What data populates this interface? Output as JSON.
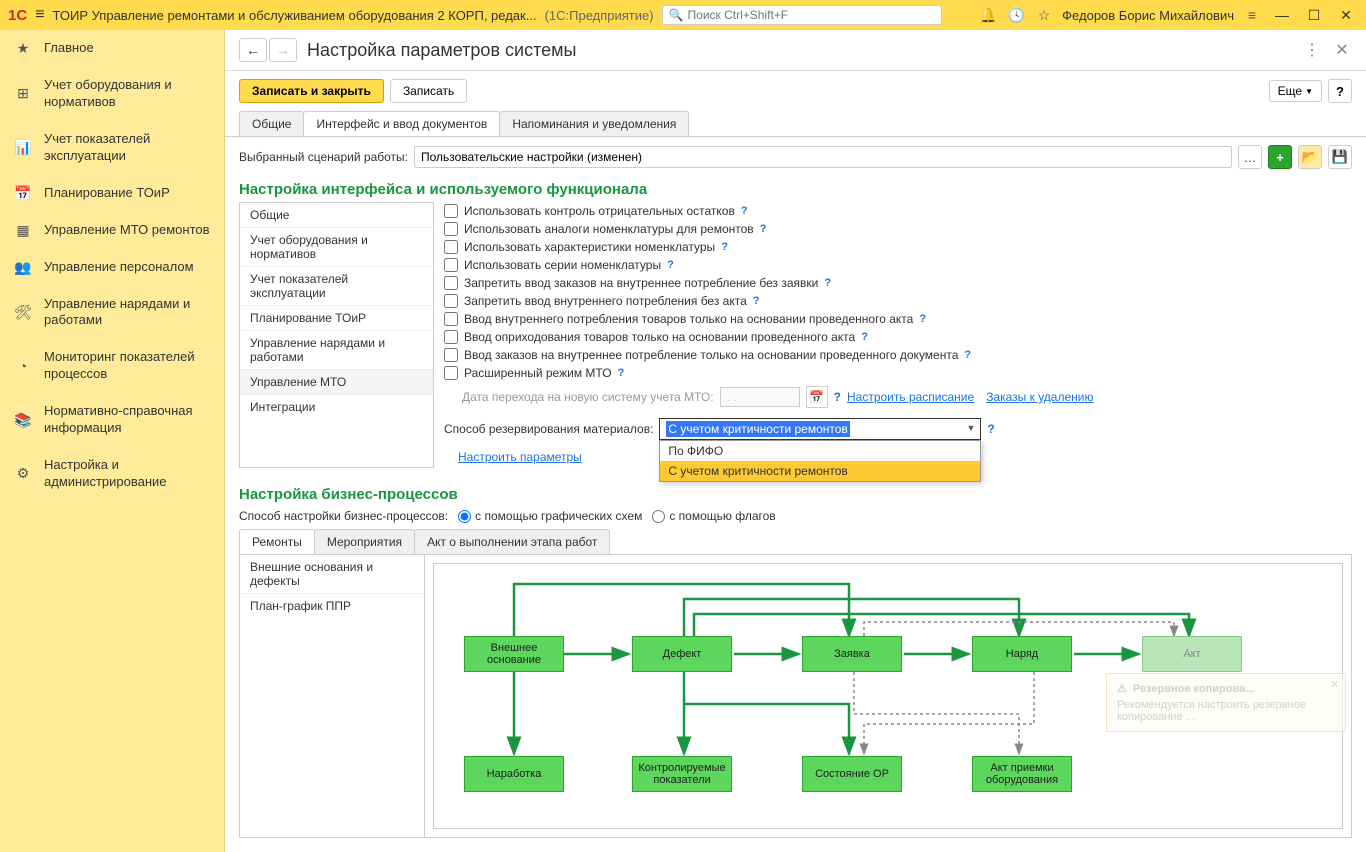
{
  "topbar": {
    "title": "ТОИР Управление ремонтами и обслуживанием оборудования 2 КОРП, редак...",
    "subtitle": "(1С:Предприятие)",
    "search_placeholder": "Поиск Ctrl+Shift+F",
    "username": "Федоров Борис Михайлович"
  },
  "sidebar": [
    {
      "icon": "★",
      "label": "Главное"
    },
    {
      "icon": "⊞",
      "label": "Учет оборудования и нормативов"
    },
    {
      "icon": "📊",
      "label": "Учет показателей эксплуатации"
    },
    {
      "icon": "📅",
      "label": "Планирование ТОиР"
    },
    {
      "icon": "▦",
      "label": "Управление МТО ремонтов"
    },
    {
      "icon": "👥",
      "label": "Управление персоналом"
    },
    {
      "icon": "🛠",
      "label": "Управление нарядами и работами"
    },
    {
      "icon": "◔",
      "label": "Мониторинг показателей процессов"
    },
    {
      "icon": "📚",
      "label": "Нормативно-справочная информация"
    },
    {
      "icon": "⚙",
      "label": "Настройка и администрирование"
    }
  ],
  "page": {
    "title": "Настройка параметров системы",
    "save_close": "Записать и закрыть",
    "save": "Записать",
    "more": "Еще",
    "tabs": [
      "Общие",
      "Интерфейс и ввод документов",
      "Напоминания и уведомления"
    ],
    "active_tab": 1,
    "scenario_label": "Выбранный сценарий работы:",
    "scenario_value": "Пользовательские настройки (изменен)"
  },
  "section1": {
    "title": "Настройка интерфейса и используемого функционала",
    "nav": [
      "Общие",
      "Учет оборудования и нормативов",
      "Учет показателей эксплуатации",
      "Планирование ТОиР",
      "Управление нарядами и работами",
      "Управление МТО",
      "Интеграции"
    ],
    "active_nav": 5,
    "checks": [
      "Использовать контроль отрицательных остатков",
      "Использовать аналоги номенклатуры для ремонтов",
      "Использовать характеристики номенклатуры",
      "Использовать серии номенклатуры",
      "Запретить ввод заказов на внутреннее потребление без заявки",
      "Запретить ввод внутреннего потребления без акта",
      "Ввод внутреннего потребления товаров только на основании проведенного акта",
      "Ввод оприходования товаров только на основании проведенного акта",
      "Ввод заказов на внутреннее потребление только на основании проведенного документа",
      "Расширенный режим МТО"
    ],
    "date_label": "Дата перехода на новую систему учета МТО:",
    "date_value": ". .",
    "schedule_link": "Настроить расписание",
    "orders_link": "Заказы к удалению",
    "reserve_label": "Способ резервирования материалов:",
    "reserve_value": "С учетом критичности ремонтов",
    "reserve_options": [
      "По ФИФО",
      "С учетом критичности ремонтов"
    ],
    "params_link": "Настроить параметры"
  },
  "section2": {
    "title": "Настройка бизнес-процессов",
    "method_label": "Способ настройки бизнес-процессов:",
    "radio1": "с помощью графических схем",
    "radio2": "с помощью флагов",
    "tabs": [
      "Ремонты",
      "Мероприятия",
      "Акт о выполнении этапа работ"
    ],
    "sidenav": [
      "Внешние основания и дефекты",
      "План-график ППР"
    ],
    "nodes": {
      "n1": "Внешнее основание",
      "n2": "Дефект",
      "n3": "Заявка",
      "n4": "Наряд",
      "n5": "Акт",
      "n6": "Наработка",
      "n7": "Контролируемые показатели",
      "n8": "Состояние ОР",
      "n9": "Акт приемки оборудования"
    }
  },
  "notification": {
    "title": "Резервное копирова...",
    "text": "Рекомендуется настроить резервное копирование ..."
  }
}
